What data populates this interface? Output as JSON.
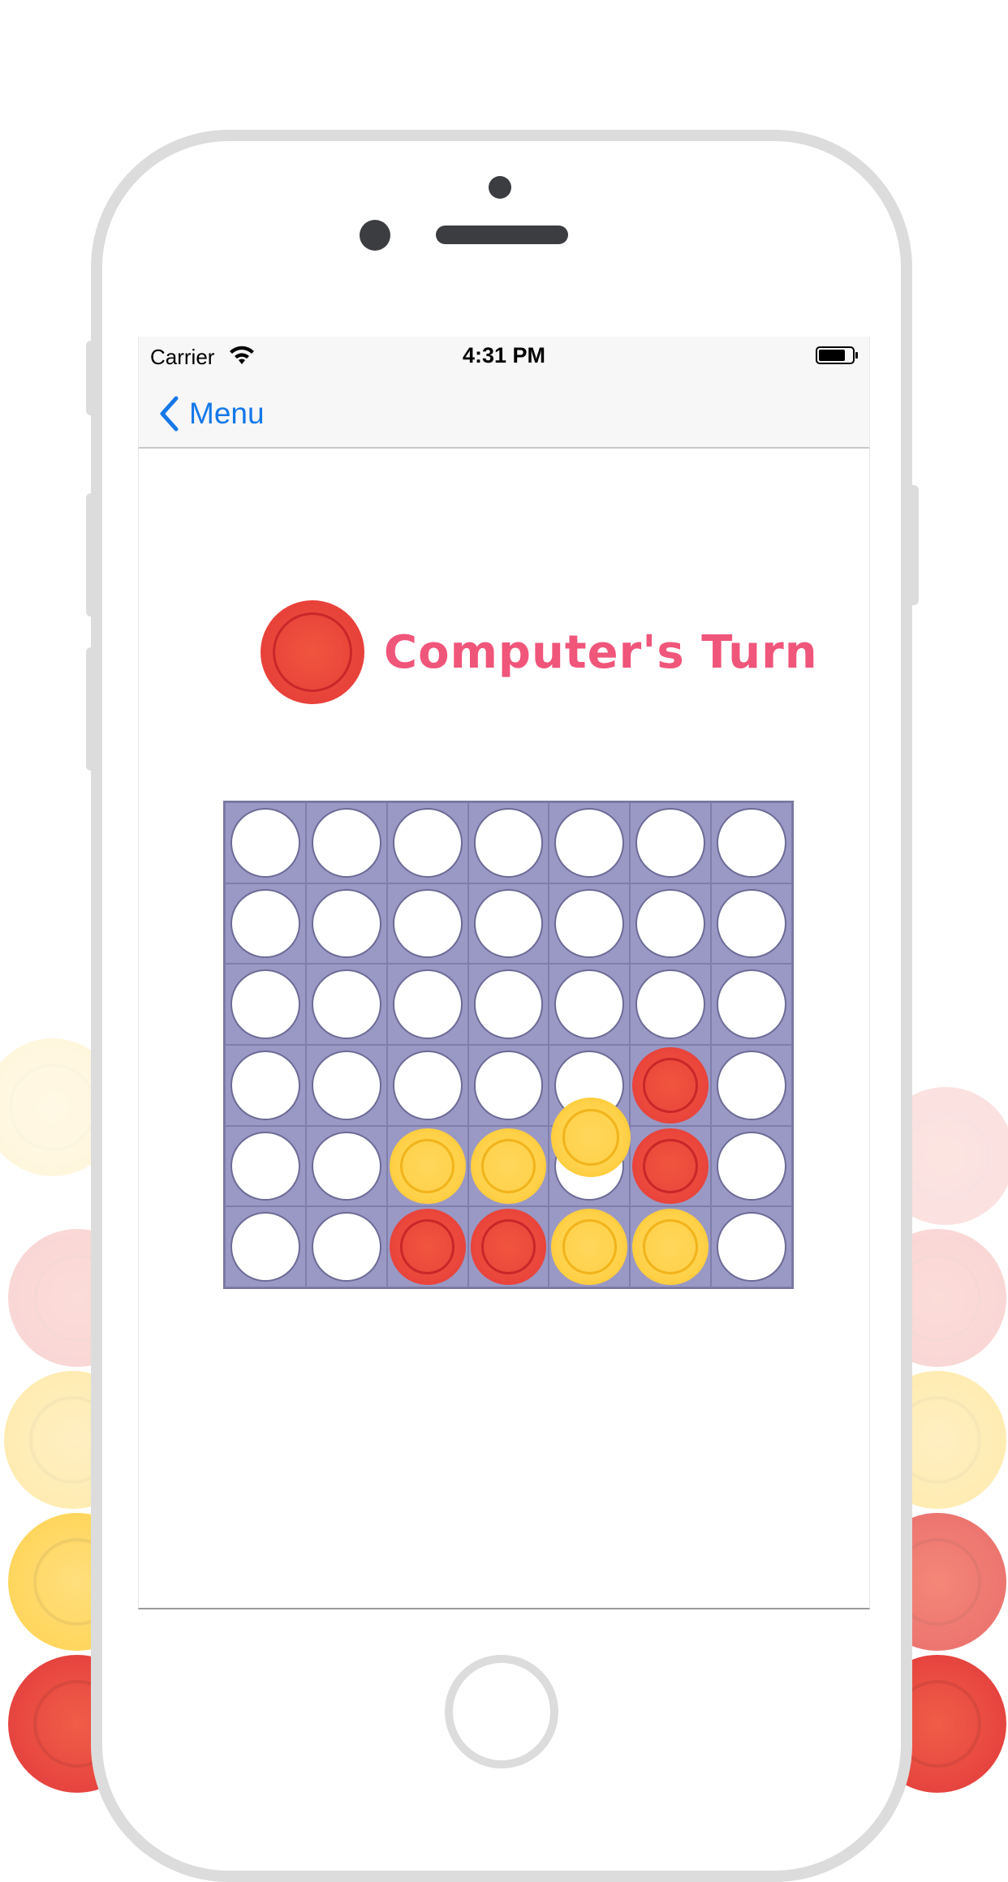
{
  "status_bar": {
    "carrier": "Carrier",
    "time": "4:31 PM"
  },
  "nav": {
    "back_label": "Menu"
  },
  "game": {
    "turn_text": "Computer's Turn",
    "turn_player": "red",
    "colors": {
      "red": "#e9443a",
      "yellow": "#ffd14a",
      "board": "#9a98c4",
      "turn_text": "#f0557a",
      "link": "#1478e8"
    },
    "board": {
      "columns": 7,
      "rows": 6,
      "cells": [
        [
          "empty",
          "empty",
          "empty",
          "empty",
          "empty",
          "empty",
          "empty"
        ],
        [
          "empty",
          "empty",
          "empty",
          "empty",
          "empty",
          "empty",
          "empty"
        ],
        [
          "empty",
          "empty",
          "empty",
          "empty",
          "empty",
          "empty",
          "empty"
        ],
        [
          "empty",
          "empty",
          "empty",
          "empty",
          "empty",
          "red",
          "empty"
        ],
        [
          "empty",
          "empty",
          "yellow",
          "yellow",
          "empty",
          "red",
          "empty"
        ],
        [
          "empty",
          "empty",
          "red",
          "red",
          "yellow",
          "yellow",
          "empty"
        ]
      ],
      "dropping_piece": {
        "color": "yellow",
        "column": 5
      }
    }
  }
}
